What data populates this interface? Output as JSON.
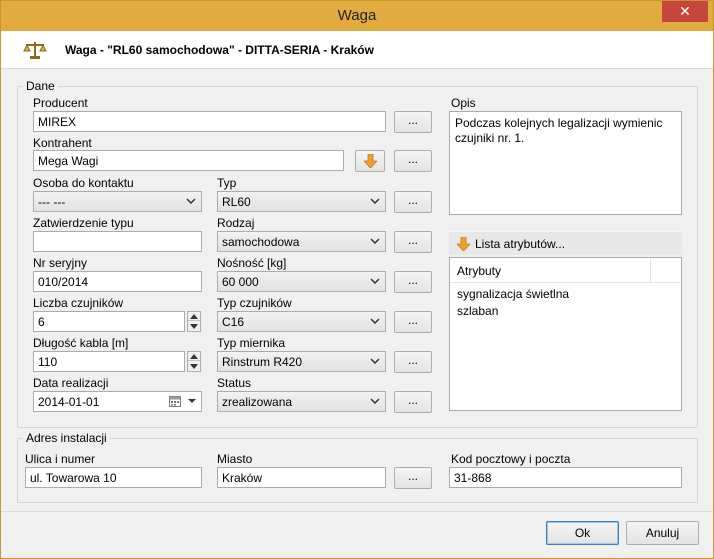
{
  "window": {
    "title": "Waga",
    "close": "✕"
  },
  "header": {
    "title": "Waga - \"RL60 samochodowa\" - DITTA-SERIA - Kraków"
  },
  "dane": {
    "group_title": "Dane",
    "producent": {
      "label": "Producent",
      "value": "MIREX"
    },
    "kontrahent": {
      "label": "Kontrahent",
      "value": "Mega Wagi"
    },
    "osoba": {
      "label": "Osoba do kontaktu",
      "value": "--- ---"
    },
    "typ": {
      "label": "Typ",
      "value": "RL60"
    },
    "zatwierdzenie": {
      "label": "Zatwierdzenie typu",
      "value": ""
    },
    "rodzaj": {
      "label": "Rodzaj",
      "value": "samochodowa"
    },
    "nr_seryjny": {
      "label": "Nr seryjny",
      "value": "010/2014"
    },
    "nosnosc": {
      "label": "Nośność [kg]",
      "value": "60 000"
    },
    "liczba_czujnikow": {
      "label": "Liczba czujników",
      "value": "6"
    },
    "typ_czujnikow": {
      "label": "Typ czujników",
      "value": "C16"
    },
    "dlugosc_kabla": {
      "label": "Długość kabla [m]",
      "value": "110"
    },
    "typ_miernika": {
      "label": "Typ miernika",
      "value": "Rinstrum R420"
    },
    "data_realizacji": {
      "label": "Data realizacji",
      "value": "2014-01-01"
    },
    "status": {
      "label": "Status",
      "value": "zrealizowana"
    },
    "dots": "...",
    "opis": {
      "label": "Opis",
      "value": "Podczas kolejnych legalizacji wymienic czujniki nr. 1."
    },
    "lista_atrybutow": "Lista atrybutów...",
    "atrybuty": {
      "header": "Atrybuty",
      "items": [
        "sygnalizacja świetlna",
        "szlaban"
      ]
    }
  },
  "adres": {
    "group_title": "Adres instalacji",
    "ulica": {
      "label": "Ulica i numer",
      "value": "ul. Towarowa 10"
    },
    "miasto": {
      "label": "Miasto",
      "value": "Kraków"
    },
    "kod": {
      "label": "Kod pocztowy i poczta",
      "value": "31-868"
    }
  },
  "buttons": {
    "ok": "Ok",
    "cancel": "Anuluj"
  },
  "icons": {
    "app": "scale-icon",
    "arrow": "orange-down-arrow-icon",
    "calendar": "calendar-icon"
  },
  "colors": {
    "titlebar": "#e1ab3f",
    "close": "#c7463b",
    "accent_arrow": "#f0a030"
  }
}
